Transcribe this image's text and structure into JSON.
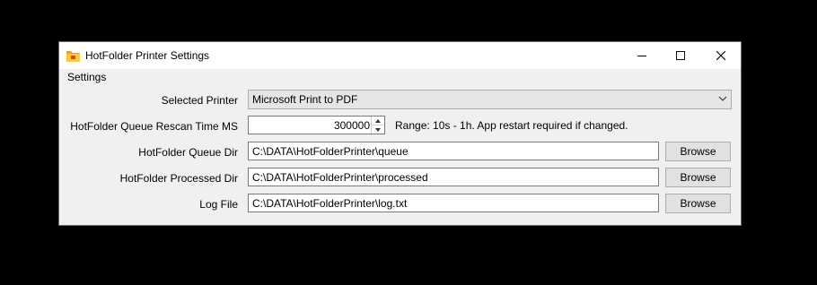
{
  "window": {
    "title": "HotFolder Printer Settings"
  },
  "group": {
    "label": "Settings"
  },
  "printer": {
    "label": "Selected Printer",
    "value": "Microsoft Print to PDF"
  },
  "rescan": {
    "label": "HotFolder Queue Rescan Time MS",
    "value": "300000",
    "hint": "Range: 10s - 1h. App restart required if changed."
  },
  "queue_dir": {
    "label": "HotFolder Queue Dir",
    "value": "C:\\DATA\\HotFolderPrinter\\queue",
    "browse": "Browse"
  },
  "processed_dir": {
    "label": "HotFolder Processed Dir",
    "value": "C:\\DATA\\HotFolderPrinter\\processed",
    "browse": "Browse"
  },
  "log_file": {
    "label": "Log File",
    "value": "C:\\DATA\\HotFolderPrinter\\log.txt",
    "browse": "Browse"
  }
}
